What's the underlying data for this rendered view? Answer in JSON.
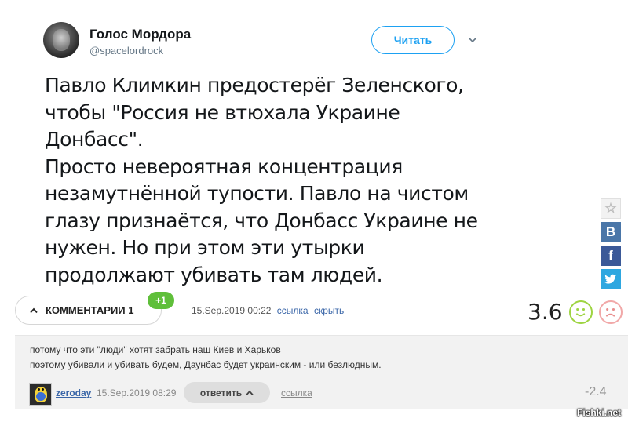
{
  "tweet": {
    "author_name": "Голос Мордора",
    "author_handle": "@spacelordrock",
    "follow_label": "Читать",
    "text": "Павло Климкин предостерёг Зеленского,\nчтобы \"Россия не втюхала Украине\nДонбасс\".\nПросто невероятная концентрация\nнезамутнённой тупости. Павло на чистом\nглазу признаётся, что Донбасс Украине не\nнужен. Но при этом эти утырки\nпродолжают убивать там людей."
  },
  "share": {
    "star_glyph": "☆",
    "vk_glyph": "В",
    "fb_glyph": "f",
    "tw_glyph": "🐦"
  },
  "post_bar": {
    "comments_label": "КОММЕНТАРИИ 1",
    "new_badge": "+1",
    "date": "15.Sep.2019 00:22",
    "link_label": "ссылка",
    "hide_label": "скрыть",
    "rating": "3.6"
  },
  "comment": {
    "text": "потому что эти \"люди\" хотят забрать наш Киев и Харьков\nпоэтому убивали и убивать будем, Даунбас будет украинским - или безлюдным.",
    "username": "zeroday",
    "date": "15.Sep.2019 08:29",
    "reply_label": "ответить",
    "link_label": "ссылка",
    "score": "-2.4"
  },
  "watermark": "Fishki.net",
  "colors": {
    "twitter_blue": "#1da1f2",
    "vk": "#4a76a8",
    "facebook": "#3b5998",
    "twitter_share": "#2ea7e0",
    "badge_green": "#5fbf3a",
    "smile_good": "#9ed442",
    "smile_bad": "#f1a8a8"
  }
}
